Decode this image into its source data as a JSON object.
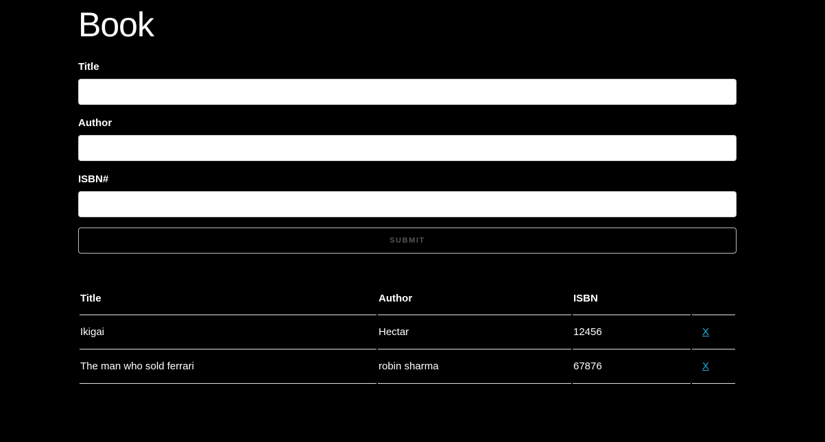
{
  "page": {
    "title": "Book"
  },
  "form": {
    "title_label": "Title",
    "title_value": "",
    "author_label": "Author",
    "author_value": "",
    "isbn_label": "ISBN#",
    "isbn_value": "",
    "submit_label": "Submit"
  },
  "table": {
    "headers": [
      "Title",
      "Author",
      "ISBN",
      ""
    ],
    "rows": [
      {
        "title": "Ikigai",
        "author": "Hectar",
        "isbn": "12456",
        "delete": "X"
      },
      {
        "title": "The man who sold ferrari",
        "author": "robin sharma",
        "isbn": "67876",
        "delete": "X"
      }
    ]
  },
  "colors": {
    "background": "#000000",
    "text": "#ffffff",
    "link": "#1eaedb",
    "submit_text": "#555555"
  }
}
